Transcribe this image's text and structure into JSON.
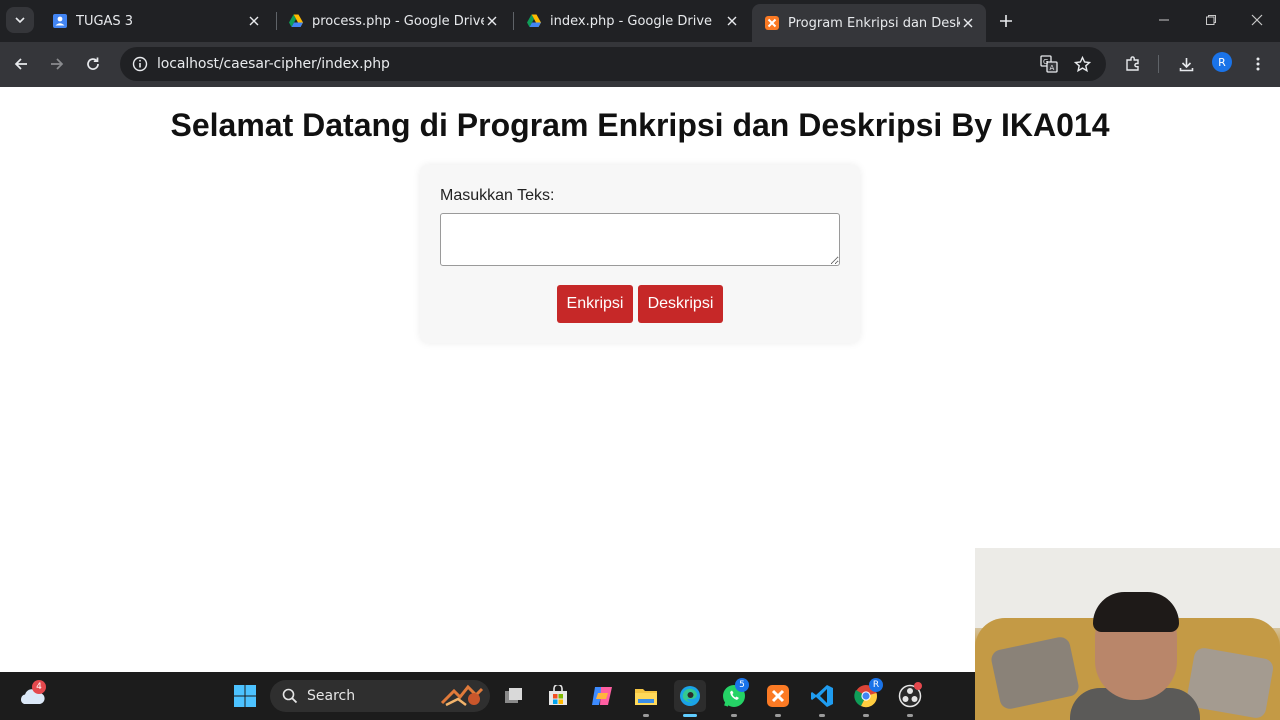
{
  "browser": {
    "tabs": [
      {
        "label": "TUGAS 3",
        "icon": "contacts-icon"
      },
      {
        "label": "process.php - Google Drive",
        "icon": "google-drive-icon"
      },
      {
        "label": "index.php - Google Drive",
        "icon": "google-drive-icon"
      },
      {
        "label": "Program Enkripsi dan Deskripsi",
        "icon": "xampp-icon",
        "active": true
      }
    ],
    "url": "localhost/caesar-cipher/index.php",
    "profile_initial": "R"
  },
  "page": {
    "title": "Selamat Datang di Program Enkripsi dan Deskripsi By IKA014",
    "input_label": "Masukkan Teks:",
    "input_value": "",
    "encrypt_button": "Enkripsi",
    "decrypt_button": "Deskripsi",
    "button_color": "#c62828"
  },
  "taskbar": {
    "search_label": "Search",
    "weather_badge": "4",
    "whatsapp_badge": "5",
    "chrome_badge": "R"
  }
}
